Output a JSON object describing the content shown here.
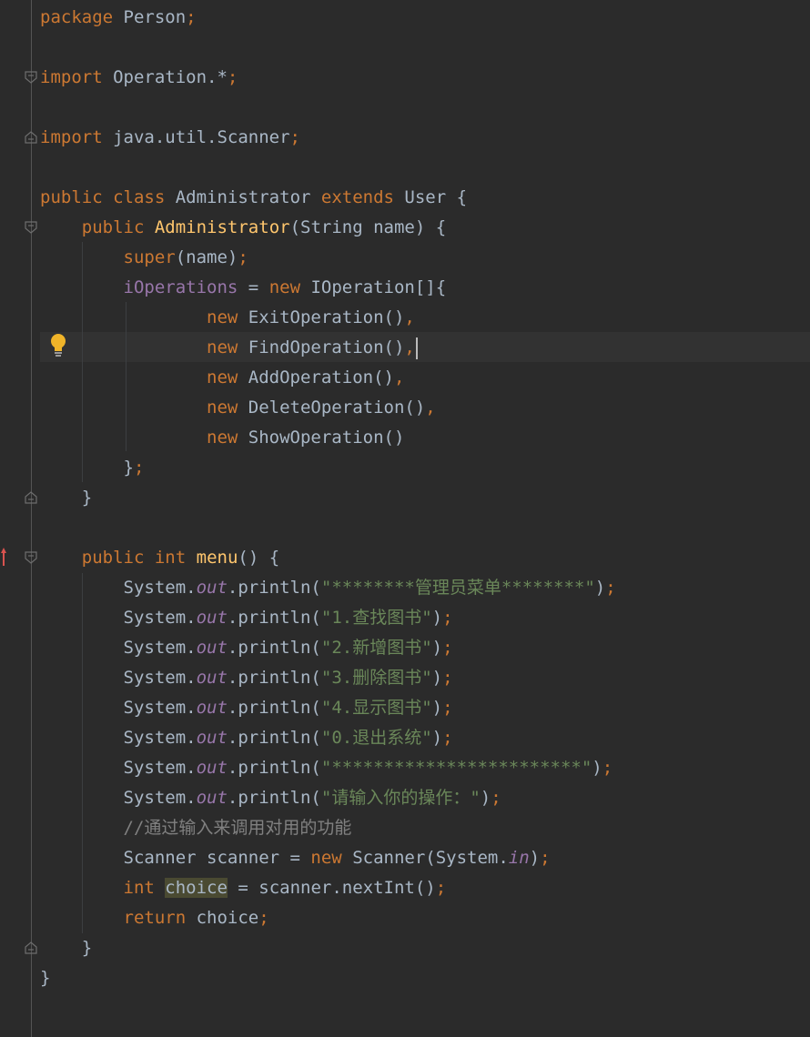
{
  "editor": {
    "lines": [
      "package Person;",
      "",
      "import Operation.*;",
      "",
      "import java.util.Scanner;",
      "",
      "public class Administrator extends User {",
      "    public Administrator(String name) {",
      "        super(name);",
      "        iOperations = new IOperation[]{",
      "                new ExitOperation(),",
      "                new FindOperation(),",
      "                new AddOperation(),",
      "                new DeleteOperation(),",
      "                new ShowOperation()",
      "        };",
      "    }",
      "",
      "    public int menu() {",
      "        System.out.println(\"********管理员菜单********\");",
      "        System.out.println(\"1.查找图书\");",
      "        System.out.println(\"2.新增图书\");",
      "        System.out.println(\"3.删除图书\");",
      "        System.out.println(\"4.显示图书\");",
      "        System.out.println(\"0.退出系统\");",
      "        System.out.println(\"************************\");",
      "        System.out.println(\"请输入你的操作：\");",
      "        //通过输入来调用对用的功能",
      "        Scanner scanner = new Scanner(System.in);",
      "        int choice = scanner.nextInt();",
      "        return choice;",
      "    }",
      "}"
    ],
    "caret_line": 12,
    "highlighted_word": "choice"
  },
  "gutter": {
    "icons": [
      "fold-icon",
      "lightbulb-icon",
      "override-arrow-icon"
    ],
    "colors": {
      "background": "#2b2b2b",
      "keyword": "#cc7832",
      "method": "#ffc66d",
      "field": "#9876aa",
      "string": "#6a8759",
      "comment": "#808080",
      "text": "#a9b7c6",
      "bulb": "#f0b429",
      "arrow": "#d9534f"
    }
  }
}
